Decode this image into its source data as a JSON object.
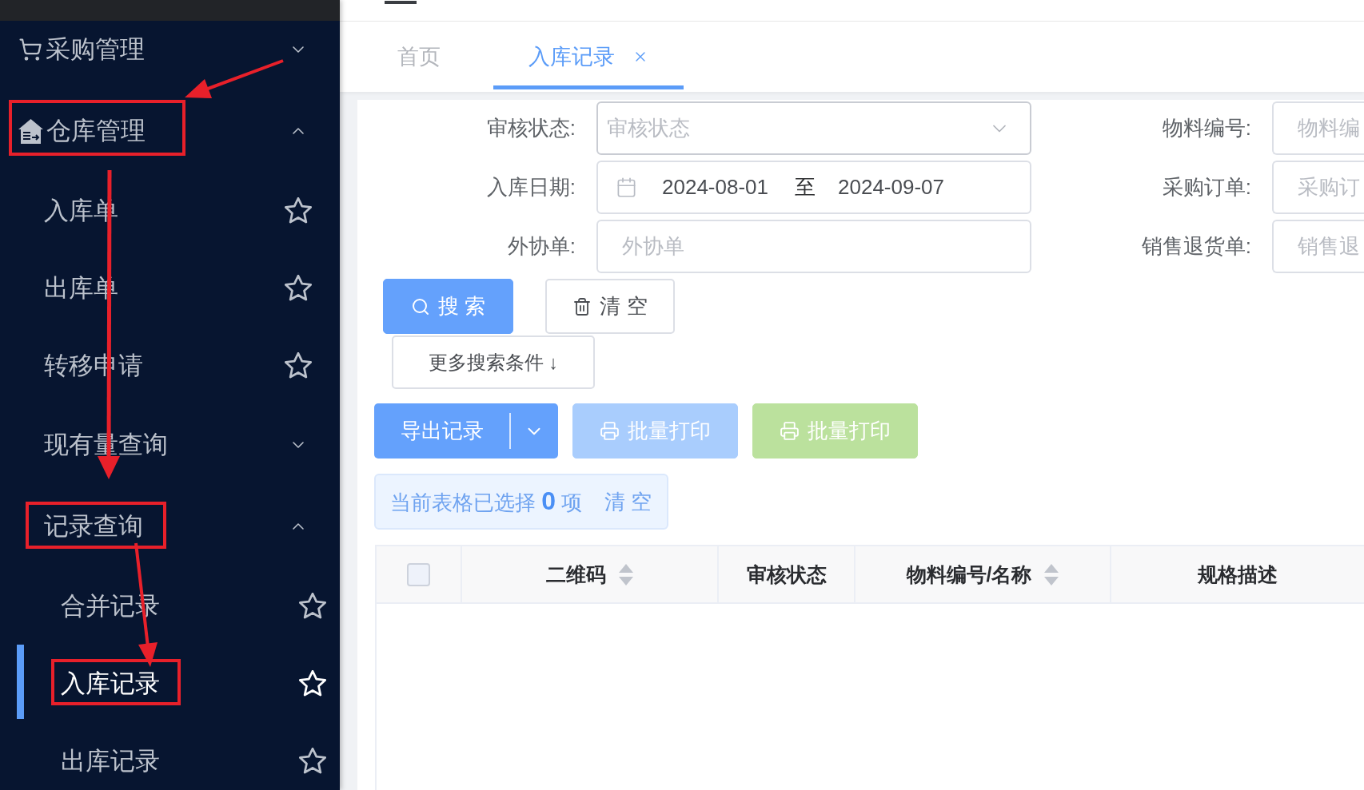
{
  "sidebar": {
    "items": [
      {
        "label": "采购管理",
        "kind": "group",
        "expanded": false,
        "selected": false
      },
      {
        "label": "仓库管理",
        "kind": "group",
        "expanded": true,
        "selected": false,
        "children": [
          {
            "label": "入库单",
            "kind": "page",
            "selected": false
          },
          {
            "label": "出库单",
            "kind": "page",
            "selected": false
          },
          {
            "label": "转移申请",
            "kind": "page",
            "selected": false
          },
          {
            "label": "现有量查询",
            "kind": "group",
            "expanded": false,
            "selected": false
          },
          {
            "label": "记录查询",
            "kind": "group",
            "expanded": true,
            "selected": false,
            "children": [
              {
                "label": "合并记录",
                "kind": "page",
                "selected": false
              },
              {
                "label": "入库记录",
                "kind": "page",
                "selected": true
              },
              {
                "label": "出库记录",
                "kind": "page",
                "selected": false
              }
            ]
          }
        ]
      }
    ]
  },
  "tabs": [
    {
      "label": "首页",
      "selected": false,
      "closable": false
    },
    {
      "label": "入库记录",
      "selected": true,
      "closable": true
    }
  ],
  "filters": [
    {
      "label": "审核状态:",
      "kind": "select",
      "placeholder": "审核状态"
    },
    {
      "label": "物料编号:",
      "kind": "input",
      "placeholder": "物料编"
    },
    {
      "label": "入库日期:",
      "kind": "date_range",
      "start": "2024-08-01",
      "separator": "至",
      "end": "2024-09-07"
    },
    {
      "label": "采购订单:",
      "kind": "input",
      "placeholder": "采购订"
    },
    {
      "label": "外协单:",
      "kind": "input",
      "placeholder": "外协单"
    },
    {
      "label": "销售退货单:",
      "kind": "input",
      "placeholder": "销售退"
    }
  ],
  "filter_buttons": [
    {
      "label": "搜 索",
      "kind": "primary"
    },
    {
      "label": "清 空",
      "kind": "default"
    }
  ],
  "more_button": {
    "label": "更多搜索条件 ↓"
  },
  "toolbar": [
    {
      "label": "导出记录",
      "kind": "split",
      "disabled": false
    },
    {
      "label": "批量打印",
      "kind": "primary",
      "disabled": true
    },
    {
      "label": "批量打印",
      "kind": "success",
      "disabled": true
    }
  ],
  "selection_alert": {
    "text": "当前表格已选择 **0** 项",
    "action": "清 空"
  },
  "table": {
    "columns": [
      {
        "kind": "checkbox",
        "checked": false
      },
      {
        "kind": "text",
        "label": "二维码",
        "sortable": true
      },
      {
        "kind": "text",
        "label": "审核状态",
        "sortable": false
      },
      {
        "kind": "text",
        "label": "物料编号/名称",
        "sortable": true
      },
      {
        "kind": "text",
        "label": "规格描述",
        "sortable": false
      }
    ]
  }
}
